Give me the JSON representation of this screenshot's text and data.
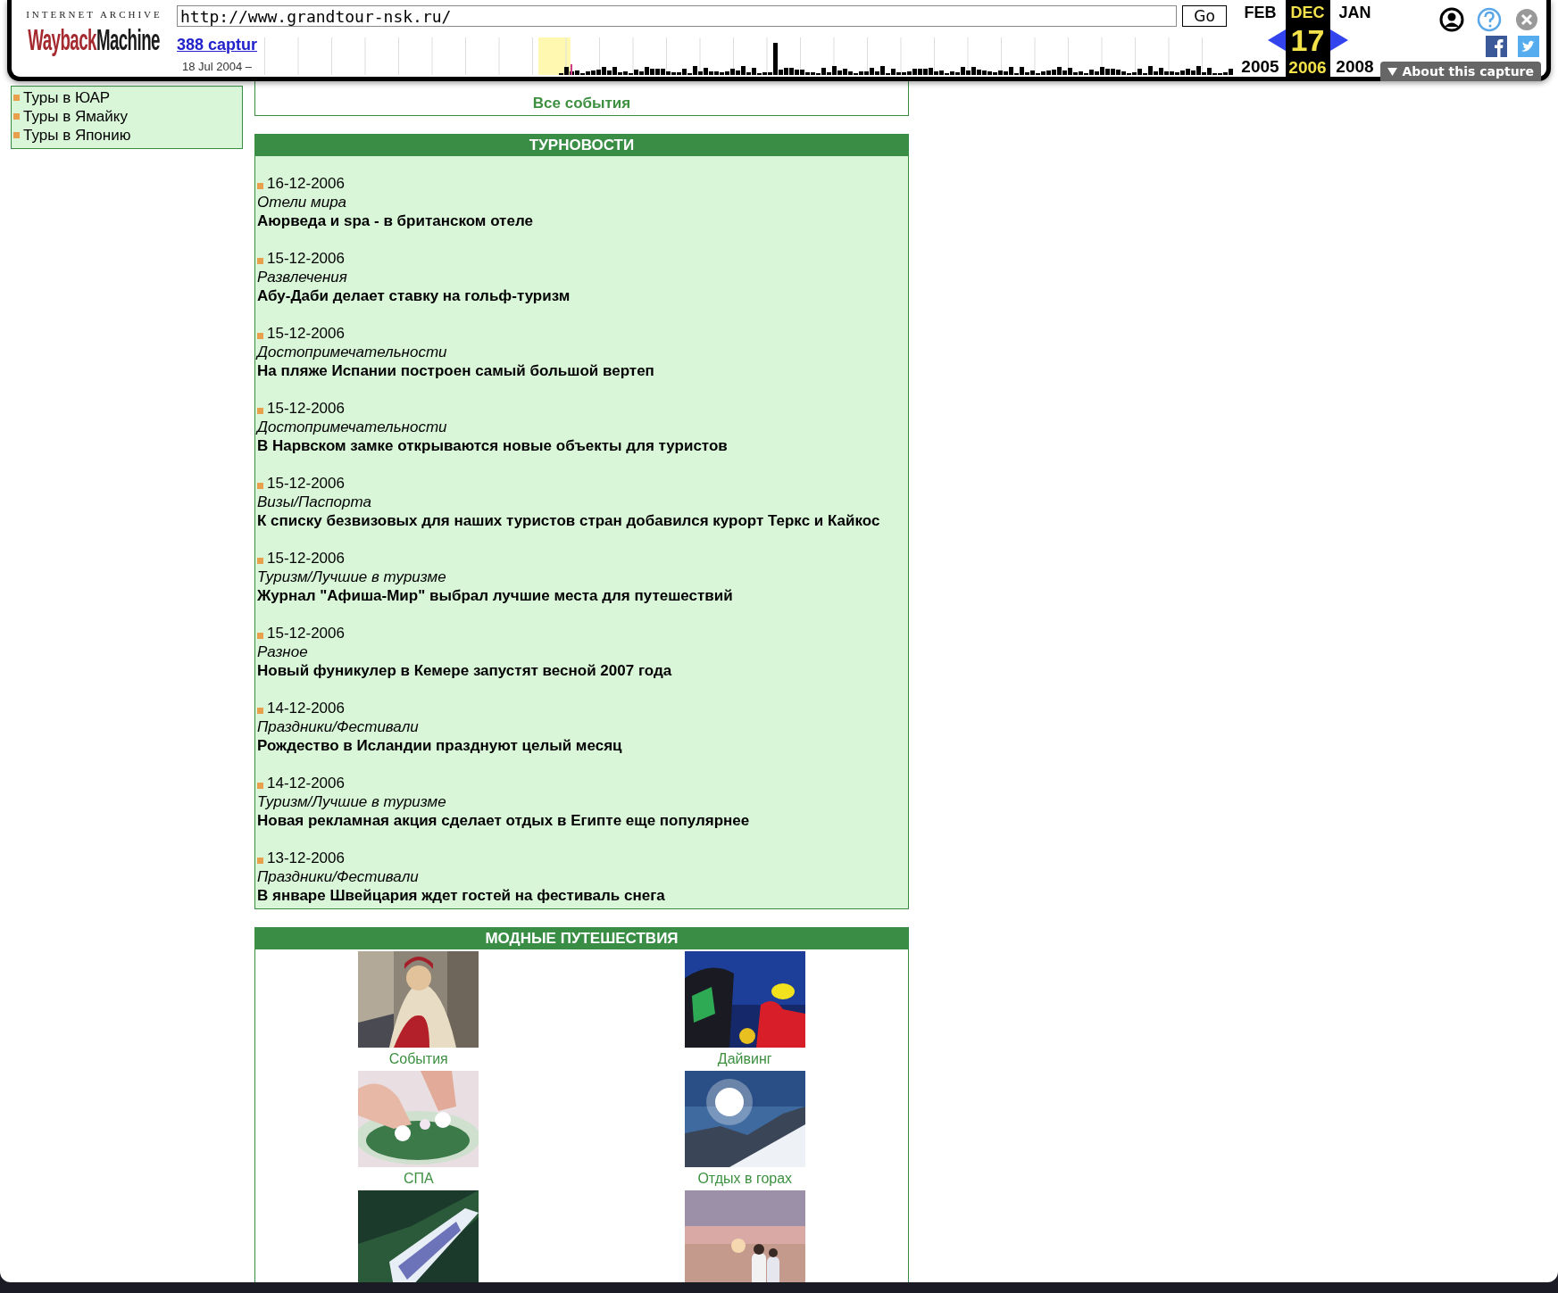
{
  "toolbar": {
    "logo_top": "INTERNET ARCHIVE",
    "logo_wayback": "Wayback",
    "logo_machine": "Machine",
    "url": "http://www.grandtour-nsk.ru/",
    "go_button": "Go",
    "captures_link": "388 captur",
    "date_range": "18 Jul 2004 –",
    "calendar": [
      {
        "month": "FEB",
        "year": "2005",
        "selected": false
      },
      {
        "month": "DEC",
        "day": "17",
        "year": "2006",
        "selected": true
      },
      {
        "month": "JAN",
        "year": "2008",
        "selected": false
      }
    ],
    "about_button": "About this capture"
  },
  "sidebar": {
    "items": [
      "Туры в ЮАР",
      "Туры в Ямайку",
      "Туры в Японию"
    ]
  },
  "all_events_link": "Все события",
  "news": {
    "title": "ТУРНОВОСТИ",
    "items": [
      {
        "date": "16-12-2006",
        "category": "Отели мира",
        "headline": "Аюрведа и spa - в британском отеле"
      },
      {
        "date": "15-12-2006",
        "category": "Развлечения",
        "headline": "Абу-Даби делает ставку на гольф-туризм"
      },
      {
        "date": "15-12-2006",
        "category": "Достопримечательности",
        "headline": "На пляже Испании построен самый большой вертеп"
      },
      {
        "date": "15-12-2006",
        "category": "Достопримечательности",
        "headline": "В Нарвском замке открываются новые объекты для туристов"
      },
      {
        "date": "15-12-2006",
        "category": "Визы/Паспорта",
        "headline": "К списку безвизовых для наших туристов стран добавился курорт Теркс и Кайкос"
      },
      {
        "date": "15-12-2006",
        "category": "Туризм/Лучшие в туризме",
        "headline": "Журнал \"Афиша-Мир\" выбрал лучшие места для путешествий"
      },
      {
        "date": "15-12-2006",
        "category": "Разное",
        "headline": "Новый фуникулер в Кемере запустят весной 2007 года"
      },
      {
        "date": "14-12-2006",
        "category": "Праздники/Фестивали",
        "headline": "Рождество в Исландии празднуют целый месяц"
      },
      {
        "date": "14-12-2006",
        "category": "Туризм/Лучшие в туризме",
        "headline": "Новая рекламная акция сделает отдых в Египте еще популярнее"
      },
      {
        "date": "13-12-2006",
        "category": "Праздники/Фестивали",
        "headline": "В январе Швейцария ждет гостей на фестиваль снега"
      }
    ]
  },
  "fashion_travel": {
    "title": "МОДНЫЕ ПУТЕШЕСТВИЯ",
    "items": [
      {
        "kind": "picture",
        "caption": "События"
      },
      {
        "kind": "picture",
        "caption": "Дайвинг"
      },
      {
        "kind": "picture",
        "caption": "СПА"
      },
      {
        "kind": "picture",
        "caption": "Отдых в горах"
      },
      {
        "kind": "picture"
      },
      {
        "kind": "picture"
      }
    ]
  }
}
